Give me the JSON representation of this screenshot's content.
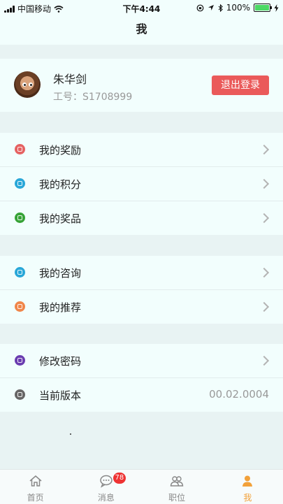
{
  "status_bar": {
    "carrier": "中国移动",
    "time": "下午4:44",
    "battery": "100%"
  },
  "nav": {
    "title": "我"
  },
  "profile": {
    "name": "朱华剑",
    "employee_id": "工号：S1708999",
    "logout_label": "退出登录"
  },
  "groups": [
    {
      "items": [
        {
          "label": "我的奖励",
          "icon": "gift-icon",
          "color": "#e56262"
        },
        {
          "label": "我的积分",
          "icon": "points-icon",
          "color": "#29a7d8"
        },
        {
          "label": "我的奖品",
          "icon": "prize-icon",
          "color": "#37a337"
        }
      ]
    },
    {
      "items": [
        {
          "label": "我的咨询",
          "icon": "chat-icon",
          "color": "#29a7d8"
        },
        {
          "label": "我的推荐",
          "icon": "user-icon",
          "color": "#f0864a"
        }
      ]
    },
    {
      "items": [
        {
          "label": "修改密码",
          "icon": "key-icon",
          "color": "#6a3db0"
        },
        {
          "label": "当前版本",
          "icon": "refresh-icon",
          "color": "#666666",
          "value": "00.02.0004"
        }
      ]
    }
  ],
  "tabs": [
    {
      "label": "首页",
      "icon": "home-icon"
    },
    {
      "label": "消息",
      "icon": "message-icon",
      "badge": "78"
    },
    {
      "label": "职位",
      "icon": "people-icon"
    },
    {
      "label": "我",
      "icon": "me-icon",
      "active": true
    }
  ],
  "colors": {
    "accent": "#f2a13a",
    "logout": "#ea5a5a",
    "badge": "#ee3333"
  }
}
